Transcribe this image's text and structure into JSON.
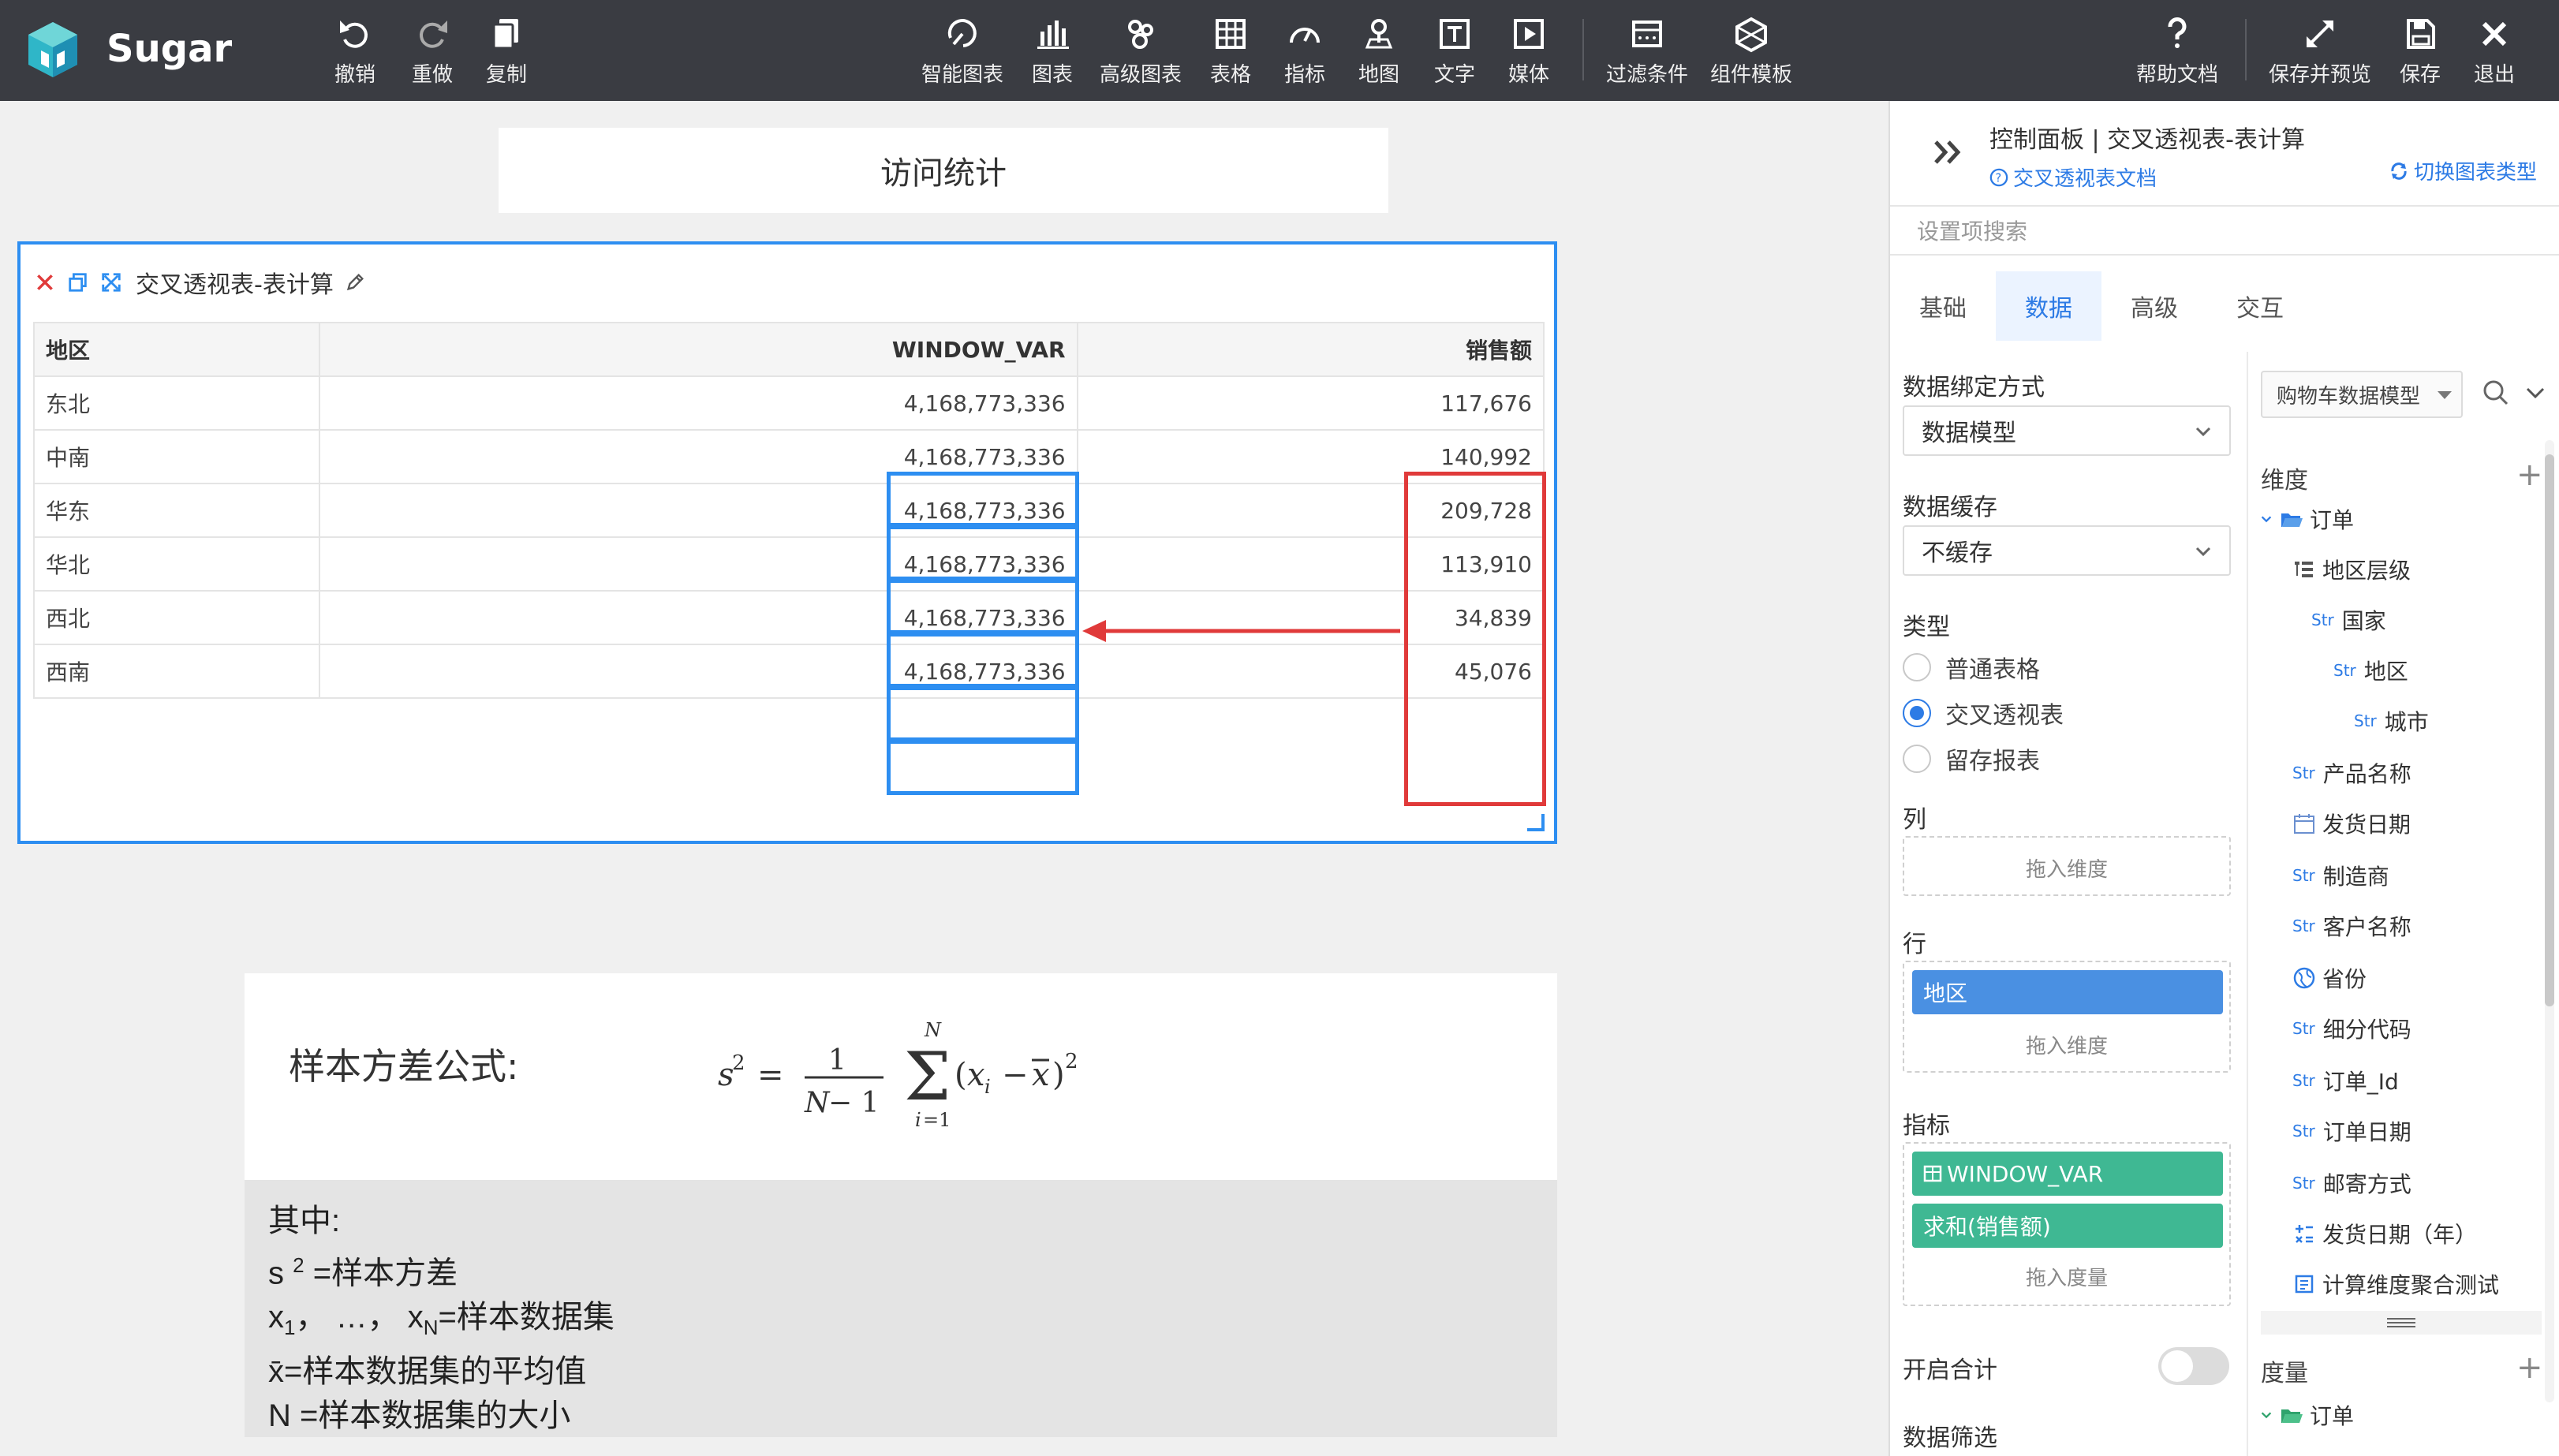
{
  "app": {
    "name": "Sugar"
  },
  "toolbar": {
    "undo": "撤销",
    "redo": "重做",
    "copy": "复制",
    "smart_chart": "智能图表",
    "chart": "图表",
    "advanced_chart": "高级图表",
    "table": "表格",
    "metric": "指标",
    "map": "地图",
    "text": "文字",
    "media": "媒体",
    "filter": "过滤条件",
    "template": "组件模板",
    "help": "帮助文档",
    "save_preview": "保存并预览",
    "save": "保存",
    "exit": "退出"
  },
  "canvas": {
    "title": "访问统计",
    "widget_title": "交叉透视表-表计算",
    "table": {
      "headers": [
        "地区",
        "WINDOW_VAR",
        "销售额"
      ],
      "rows": [
        [
          "东北",
          "4,168,773,336",
          "117,676"
        ],
        [
          "中南",
          "4,168,773,336",
          "140,992"
        ],
        [
          "华东",
          "4,168,773,336",
          "209,728"
        ],
        [
          "华北",
          "4,168,773,336",
          "113,910"
        ],
        [
          "西北",
          "4,168,773,336",
          "34,839"
        ],
        [
          "西南",
          "4,168,773,336",
          "45,076"
        ]
      ]
    },
    "formula_label": "样本方差公式:",
    "formula_latex": "s^2 = \\frac{1}{N-1}\\sum_{i=1}^{N}(x_i - \\bar{x})^2",
    "notes": {
      "intro": "其中:",
      "s": "s",
      "s_sup": "2",
      "s_desc": "=样本方差",
      "x1": "x",
      "x1_sub": "1",
      "mid": "， …， ",
      "xn": "x",
      "xn_sub": "N",
      "x_desc": "=样本数据集",
      "mean": "x̄=样本数据集的平均值",
      "n": "N =样本数据集的大小"
    },
    "colors": {
      "highlight_blue": "#2d8ef1",
      "highlight_red": "#e03a3a"
    }
  },
  "panel": {
    "title": "控制面板 | 交叉透视表-表计算",
    "doc_link": "交叉透视表文档",
    "switch_link": "切换图表类型",
    "search_placeholder": "设置项搜索",
    "tabs": [
      "基础",
      "数据",
      "高级",
      "交互"
    ],
    "active_tab": "数据",
    "binding_label": "数据绑定方式",
    "binding_value": "数据模型",
    "cache_label": "数据缓存",
    "cache_value": "不缓存",
    "type_label": "类型",
    "type_options": [
      "普通表格",
      "交叉透视表",
      "留存报表"
    ],
    "type_selected": "交叉透视表",
    "columns_label": "列",
    "drop_dimension": "拖入维度",
    "rows_label": "行",
    "row_chip": "地区",
    "metrics_label": "指标",
    "metric_chips": [
      "WINDOW_VAR",
      "求和(销售额)"
    ],
    "drop_measure": "拖入度量",
    "total_label": "开启合计",
    "filter_label": "数据筛选",
    "model_select": "购物车数据模型",
    "dimensions_label": "维度",
    "measures_label": "度量",
    "str_tag": "Str",
    "dim_folder": "订单",
    "dim_items": [
      "地区层级",
      "国家",
      "地区",
      "城市",
      "产品名称",
      "发货日期",
      "制造商",
      "客户名称",
      "省份",
      "细分代码",
      "订单_Id",
      "订单日期",
      "邮寄方式",
      "发货日期（年）",
      "计算维度聚合测试"
    ],
    "measure_folder": "订单"
  }
}
